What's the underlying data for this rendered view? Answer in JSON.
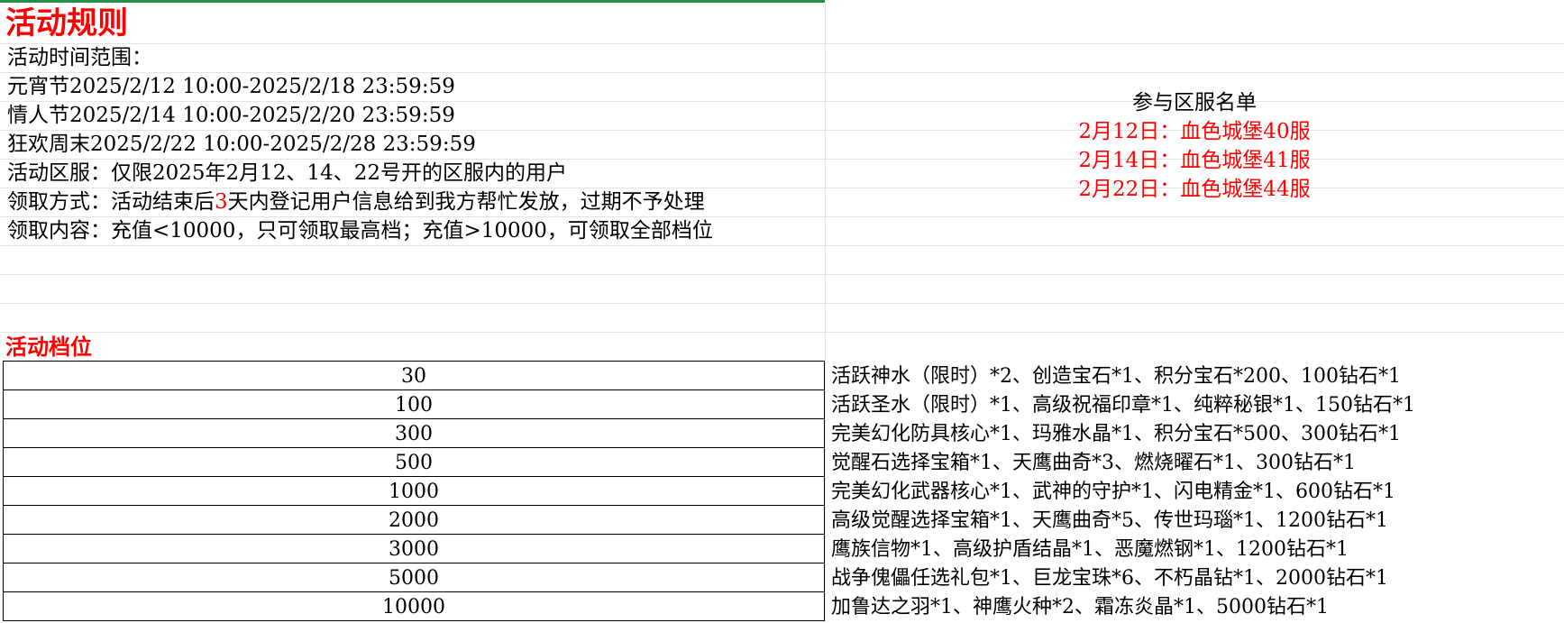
{
  "title": "活动规则",
  "colors": {
    "accent_red": "#ff0000",
    "top_bar_green": "#1f8f4a"
  },
  "rules": {
    "time_range_label": "活动时间范围：",
    "periods": [
      "元宵节2025/2/12 10:00-2025/2/18 23:59:59",
      "情人节2025/2/14 10:00-2025/2/20 23:59:59",
      "狂欢周末2025/2/22 10:00-2025/2/28 23:59:59"
    ],
    "servers_rule": "活动区服：仅限2025年2月12、14、22号开的区服内的用户",
    "claim_method_prefix": "领取方式：活动结束后",
    "claim_method_days": "3",
    "claim_method_suffix": "天内登记用户信息给到我方帮忙发放，过期不予处理",
    "claim_content": "领取内容：充值<10000，只可领取最高档；充值>10000，可领取全部档位"
  },
  "server_list": {
    "heading": "参与区服名单",
    "items": [
      "2月12日：血色城堡40服",
      "2月14日：血色城堡41服",
      "2月22日：血色城堡44服"
    ]
  },
  "tiers_heading": "活动档位",
  "tiers": [
    {
      "amount": "30",
      "reward": "活跃神水（限时）*2、创造宝石*1、积分宝石*200、100钻石*1"
    },
    {
      "amount": "100",
      "reward": "活跃圣水（限时）*1、高级祝福印章*1、纯粹秘银*1、150钻石*1"
    },
    {
      "amount": "300",
      "reward": "完美幻化防具核心*1、玛雅水晶*1、积分宝石*500、300钻石*1"
    },
    {
      "amount": "500",
      "reward": "觉醒石选择宝箱*1、天鹰曲奇*3、燃烧曜石*1、300钻石*1"
    },
    {
      "amount": "1000",
      "reward": "完美幻化武器核心*1、武神的守护*1、闪电精金*1、600钻石*1"
    },
    {
      "amount": "2000",
      "reward": "高级觉醒选择宝箱*1、天鹰曲奇*5、传世玛瑙*1、1200钻石*1"
    },
    {
      "amount": "3000",
      "reward": "鹰族信物*1、高级护盾结晶*1、恶魔燃钢*1、1200钻石*1"
    },
    {
      "amount": "5000",
      "reward": "战争傀儡任选礼包*1、巨龙宝珠*6、不朽晶钻*1、2000钻石*1"
    },
    {
      "amount": "10000",
      "reward": "加鲁达之羽*1、神鹰火种*2、霜冻炎晶*1、5000钻石*1"
    }
  ]
}
